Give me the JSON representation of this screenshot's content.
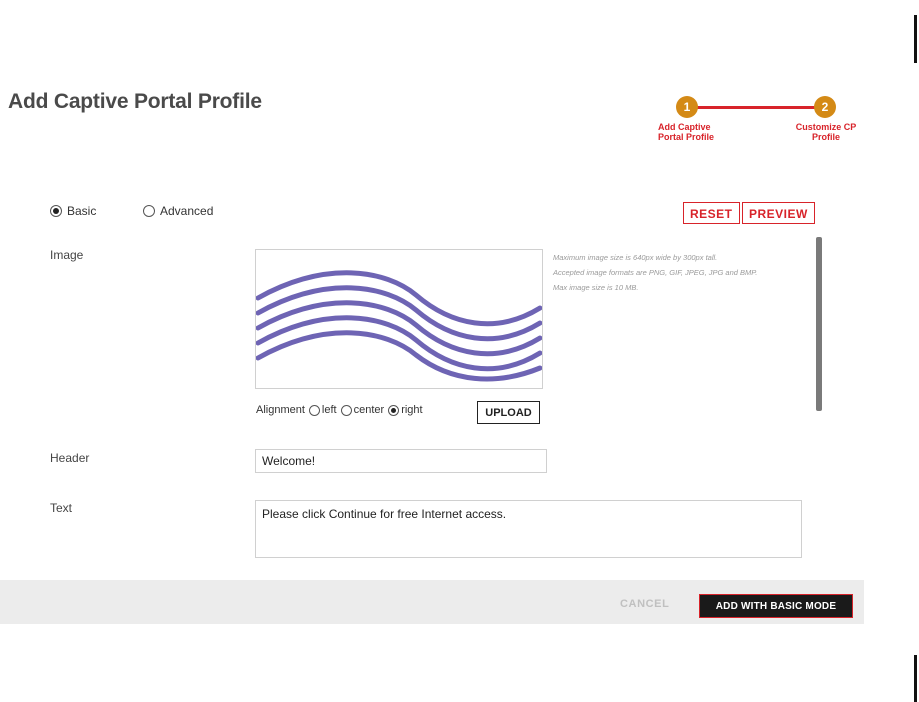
{
  "page": {
    "title": "Add Captive Portal Profile"
  },
  "stepper": {
    "steps": [
      {
        "number": "1",
        "label": "Add Captive Portal Profile"
      },
      {
        "number": "2",
        "label": "Customize CP Profile"
      }
    ]
  },
  "mode": {
    "options": [
      {
        "label": "Basic",
        "checked": true
      },
      {
        "label": "Advanced",
        "checked": false
      }
    ]
  },
  "actions": {
    "reset_label": "RESET",
    "preview_label": "PREVIEW"
  },
  "form": {
    "image_label": "Image",
    "image_help": [
      "Maximum image size is 640px wide by 300px tall.",
      "Accepted image formats are PNG, GIF, JPEG, JPG and BMP.",
      "Max image size is 10 MB."
    ],
    "alignment_label": "Alignment",
    "alignment_options": [
      {
        "label": "left",
        "checked": false
      },
      {
        "label": "center",
        "checked": false
      },
      {
        "label": "right",
        "checked": true
      }
    ],
    "upload_label": "UPLOAD",
    "header_label": "Header",
    "header_value": "Welcome!",
    "text_label": "Text",
    "text_value": "Please click Continue for free Internet access."
  },
  "footer": {
    "cancel_label": "CANCEL",
    "submit_label": "ADD WITH BASIC MODE"
  },
  "colors": {
    "accent": "#d8232a",
    "step": "#d48a16",
    "wave": "#6e64b4"
  }
}
